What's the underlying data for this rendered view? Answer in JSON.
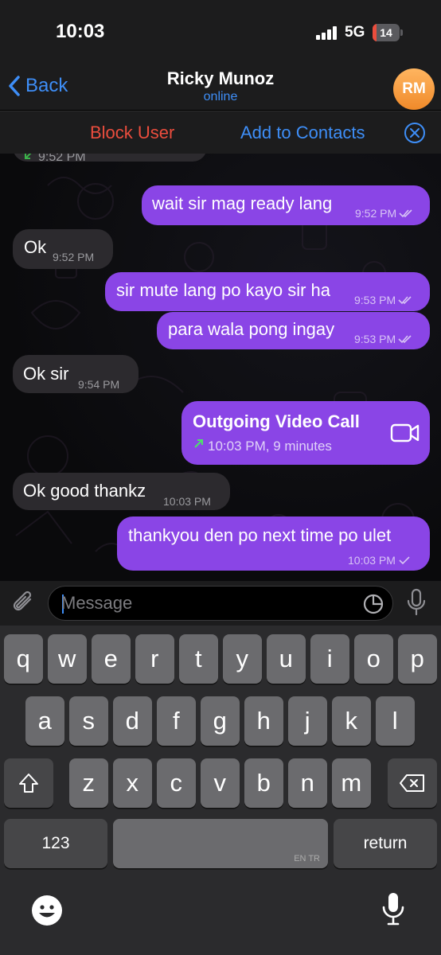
{
  "status_bar": {
    "time": "10:03",
    "network": "5G",
    "battery": "14",
    "battery_level": 0.14
  },
  "header": {
    "back_label": "Back",
    "contact_name": "Ricky Munoz",
    "contact_status": "online",
    "avatar_initials": "RM"
  },
  "action_bar": {
    "block_label": "Block User",
    "add_label": "Add to Contacts"
  },
  "messages": [
    {
      "direction": "in",
      "text": "",
      "time": "9:52 PM",
      "status": "none"
    },
    {
      "direction": "out",
      "text": "wait sir mag ready lang",
      "time": "9:52 PM",
      "status": "read"
    },
    {
      "direction": "in",
      "text": "Ok",
      "time": "9:52 PM",
      "status": "none"
    },
    {
      "direction": "out",
      "text": "sir mute lang po kayo sir ha",
      "time": "9:53 PM",
      "status": "read"
    },
    {
      "direction": "out",
      "text": "para wala pong ingay",
      "time": "9:53 PM",
      "status": "read"
    },
    {
      "direction": "in",
      "text": "Ok sir",
      "time": "9:54 PM",
      "status": "none"
    },
    {
      "direction": "out",
      "text": "Outgoing Video Call",
      "time": "10:03 PM, 9 minutes",
      "status": "call"
    },
    {
      "direction": "in",
      "text": "Ok good thankz",
      "time": "10:03 PM",
      "status": "none"
    },
    {
      "direction": "out",
      "text": "thankyou den po next time po ulet",
      "time": "10:03 PM",
      "status": "sent"
    }
  ],
  "composer": {
    "placeholder": "Message"
  },
  "keyboard": {
    "row1": [
      "q",
      "w",
      "e",
      "r",
      "t",
      "y",
      "u",
      "i",
      "o",
      "p"
    ],
    "row2": [
      "a",
      "s",
      "d",
      "f",
      "g",
      "h",
      "j",
      "k",
      "l"
    ],
    "row3": [
      "z",
      "x",
      "c",
      "v",
      "b",
      "n",
      "m"
    ],
    "numbers_label": "123",
    "space_sub": "EN TR",
    "return_label": "return"
  },
  "colors": {
    "accent": "#3e8ef7",
    "danger": "#eb4d3d",
    "outgoing_bubble": "#8a45e6",
    "incoming_bubble": "#2c2a2e"
  },
  "icons": [
    "chevron-left-icon",
    "close-circle-icon",
    "double-check-icon",
    "single-check-icon",
    "phone-arrow-icon",
    "video-camera-icon",
    "paperclip-icon",
    "sticker-icon",
    "microphone-icon",
    "shift-icon",
    "backspace-icon",
    "emoji-icon",
    "dictation-icon"
  ]
}
